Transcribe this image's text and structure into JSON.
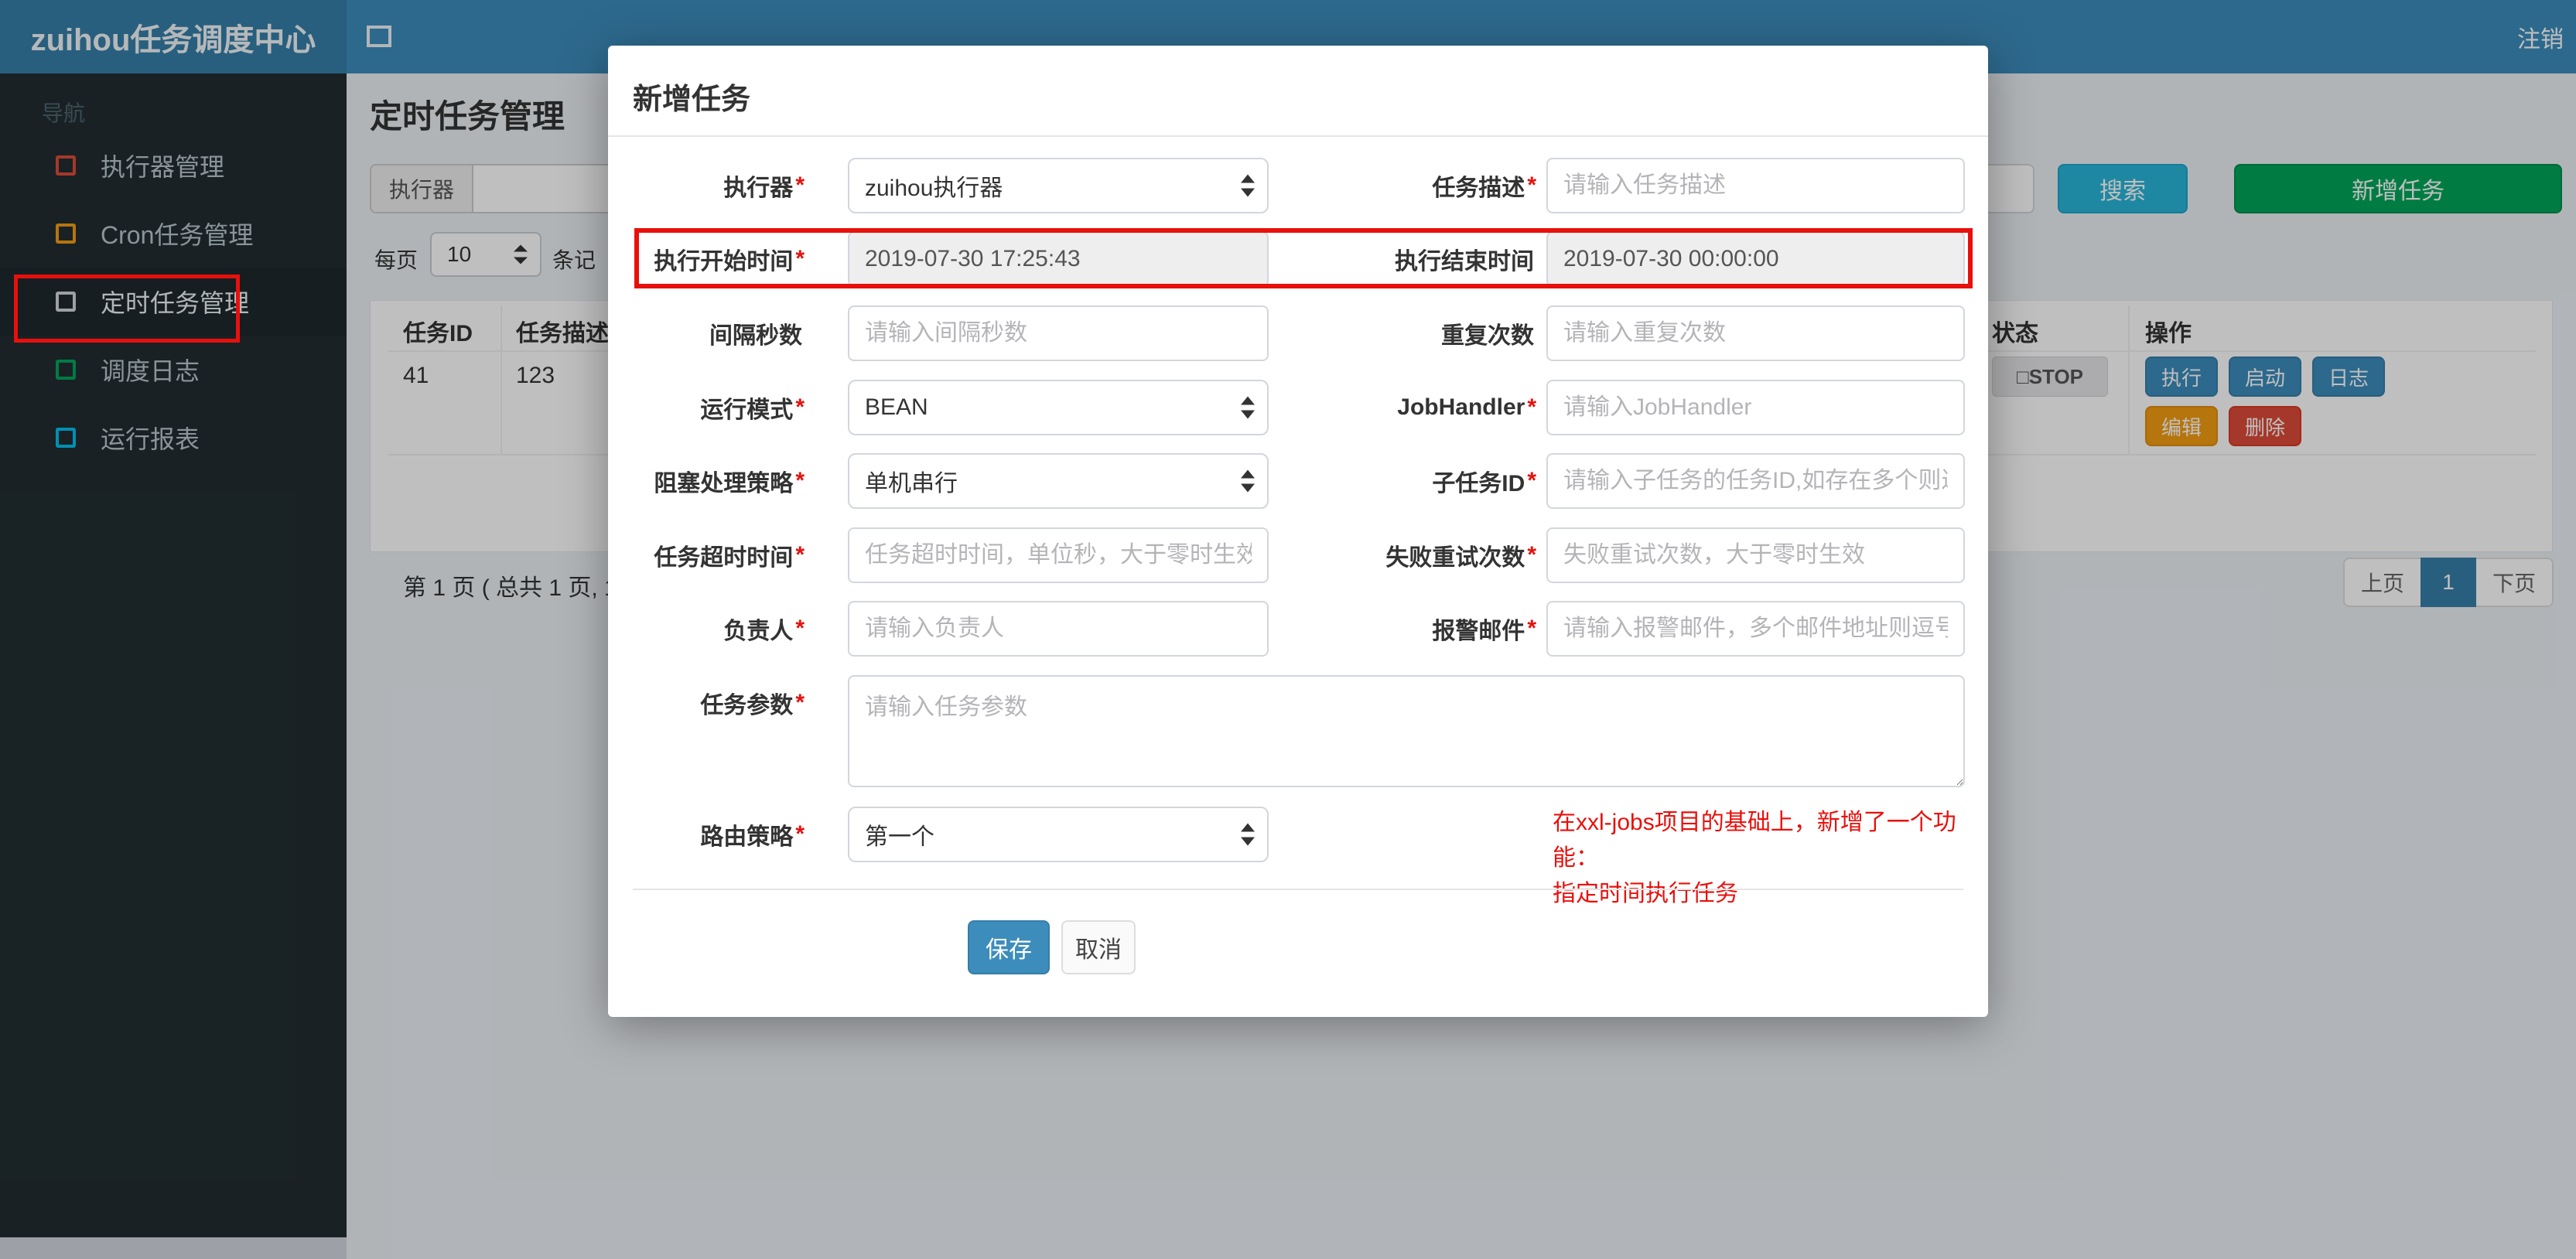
{
  "topbar": {
    "brand": "zuihou任务调度中心",
    "logout": "注销"
  },
  "sidebar": {
    "nav_label": "导航",
    "items": [
      {
        "label": "执行器管理",
        "icon_color": "#dd4b39"
      },
      {
        "label": "Cron任务管理",
        "icon_color": "#f39c12"
      },
      {
        "label": "定时任务管理",
        "icon_color": "#d2d6de",
        "active": true
      },
      {
        "label": "调度日志",
        "icon_color": "#00a65a"
      },
      {
        "label": "运行报表",
        "icon_color": "#00c0ef"
      }
    ]
  },
  "page": {
    "title": "定时任务管理",
    "filter": {
      "executor_label": "执行器",
      "search_button": "搜索",
      "add_button": "新增任务"
    },
    "perpage": {
      "prefix": "每页",
      "value": "10",
      "suffix": "条记"
    },
    "table": {
      "headers": {
        "id": "任务ID",
        "desc": "任务描述",
        "status": "状态",
        "actions": "操作"
      },
      "row": {
        "id": "41",
        "desc": "123",
        "status": "□STOP",
        "actions": {
          "run": "执行",
          "start": "启动",
          "log": "日志",
          "edit": "编辑",
          "delete": "删除"
        }
      }
    },
    "footer": {
      "summary": "第 1 页 ( 总共 1 页, 1",
      "prev": "上页",
      "page": "1",
      "next": "下页"
    }
  },
  "modal": {
    "title": "新增任务",
    "fields": {
      "executor": {
        "label": "执行器",
        "required": "*",
        "value": "zuihou执行器"
      },
      "desc": {
        "label": "任务描述",
        "required": "*",
        "placeholder": "请输入任务描述"
      },
      "start_time": {
        "label": "执行开始时间",
        "required": "*",
        "value": "2019-07-30 17:25:43"
      },
      "end_time": {
        "label": "执行结束时间",
        "value": "2019-07-30 00:00:00"
      },
      "interval": {
        "label": "间隔秒数",
        "placeholder": "请输入间隔秒数"
      },
      "repeat": {
        "label": "重复次数",
        "placeholder": "请输入重复次数"
      },
      "glue_type": {
        "label": "运行模式",
        "required": "*",
        "value": "BEAN"
      },
      "job_handler": {
        "label": "JobHandler",
        "required": "*",
        "placeholder": "请输入JobHandler"
      },
      "block_strategy": {
        "label": "阻塞处理策略",
        "required": "*",
        "value": "单机串行"
      },
      "child_job": {
        "label": "子任务ID",
        "required": "*",
        "placeholder": "请输入子任务的任务ID,如存在多个则逗"
      },
      "timeout": {
        "label": "任务超时时间",
        "required": "*",
        "placeholder": "任务超时时间，单位秒，大于零时生效"
      },
      "fail_retry": {
        "label": "失败重试次数",
        "required": "*",
        "placeholder": "失败重试次数，大于零时生效"
      },
      "author": {
        "label": "负责人",
        "required": "*",
        "placeholder": "请输入负责人"
      },
      "alarm_email": {
        "label": "报警邮件",
        "required": "*",
        "placeholder": "请输入报警邮件，多个邮件地址则逗号分"
      },
      "job_param": {
        "label": "任务参数",
        "required": "*",
        "placeholder": "请输入任务参数"
      },
      "route_strategy": {
        "label": "路由策略",
        "required": "*",
        "value": "第一个"
      }
    },
    "note": {
      "line1": "在xxl-jobs项目的基础上，新增了一个功能：",
      "line2": "指定时间执行任务",
      "color": "#e8100c"
    },
    "buttons": {
      "save": "保存",
      "cancel": "取消"
    }
  },
  "colors": {
    "navbar": "#3c8dbc",
    "brand_bg": "#367fa9",
    "sidebar_bg": "#222d32",
    "primary": "#3c8dbc",
    "success": "#00a65a",
    "info": "#29b6d8",
    "warning": "#f39c12",
    "danger": "#dd4b39",
    "annotation_red": "#e8100c",
    "pager_active": "#367fa9"
  }
}
